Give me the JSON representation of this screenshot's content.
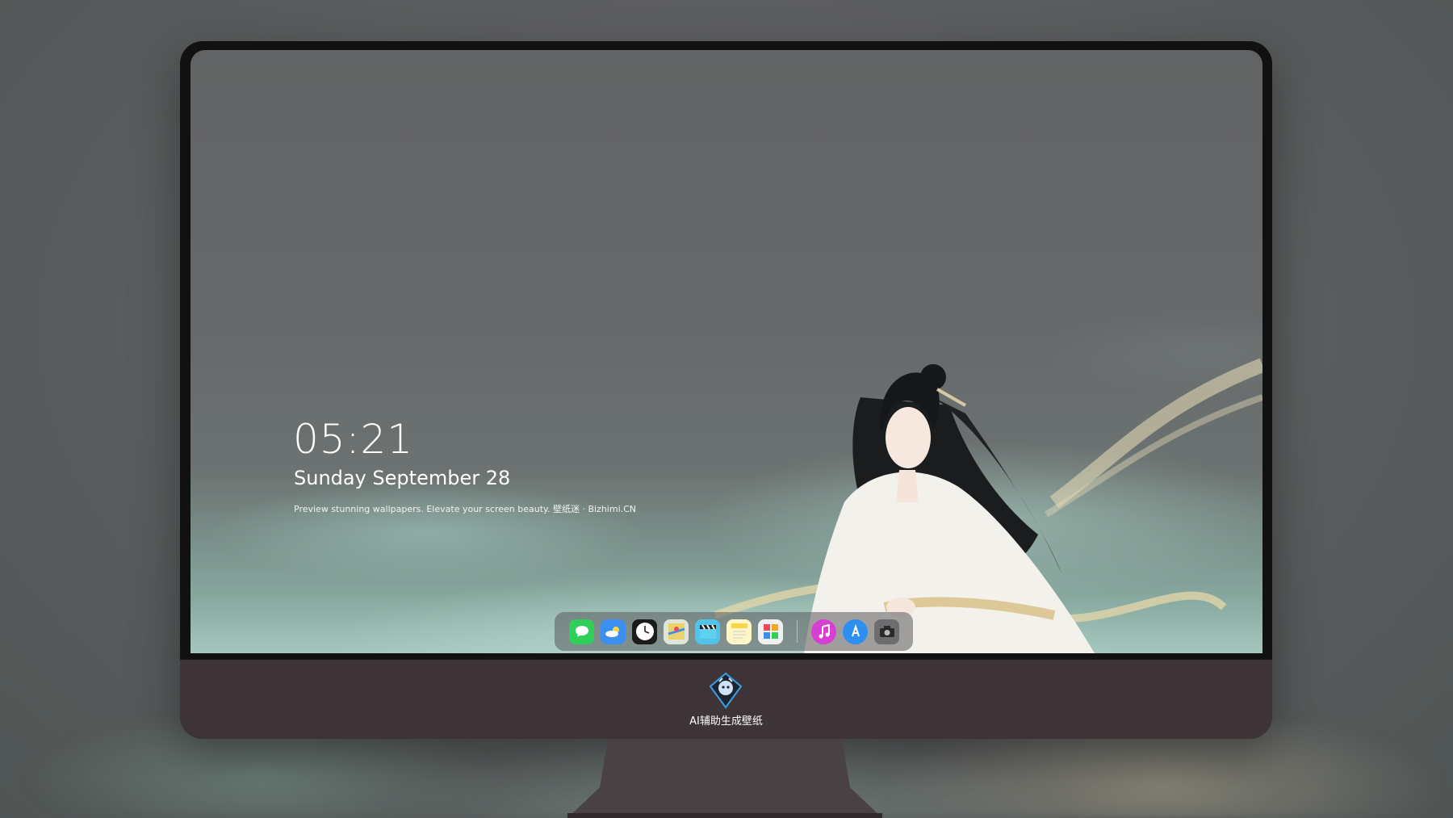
{
  "lockscreen": {
    "time": "05:21",
    "date": "Sunday September  28",
    "tagline": "Preview stunning wallpapers. Elevate your screen beauty. 壁纸迷 · Bizhimi.CN"
  },
  "monitor": {
    "brand_label": "AI辅助生成壁纸"
  },
  "dock": {
    "apps": [
      {
        "name": "messages",
        "icon": "chat-bubble-icon",
        "color": "#2fcf5a"
      },
      {
        "name": "weather",
        "icon": "cloud-sun-icon",
        "color": "#3b8ff0"
      },
      {
        "name": "clock",
        "icon": "clock-icon",
        "color": "#ffffff"
      },
      {
        "name": "maps",
        "icon": "map-icon",
        "color": "#e9d36a"
      },
      {
        "name": "video",
        "icon": "clapperboard-icon",
        "color": "#4fc3e8"
      },
      {
        "name": "notes",
        "icon": "notes-icon",
        "color": "#f9d54a"
      },
      {
        "name": "photos",
        "icon": "photos-icon",
        "color": "#e94b5b"
      },
      {
        "name": "music",
        "icon": "music-note-icon",
        "color": "#d73fd3"
      },
      {
        "name": "app-store",
        "icon": "app-store-icon",
        "color": "#2f8ff0"
      },
      {
        "name": "camera",
        "icon": "camera-icon",
        "color": "#6d6d70"
      }
    ]
  }
}
